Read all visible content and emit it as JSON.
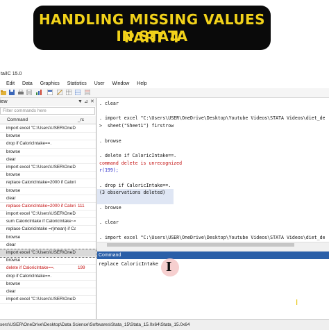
{
  "banner": {
    "line1": "HANDLING MISSING VALUES IN STATA",
    "line2": "PART 4"
  },
  "window": {
    "title": "ta/IC 15.0"
  },
  "menu": [
    "Edit",
    "Data",
    "Graphics",
    "Statistics",
    "User",
    "Window",
    "Help"
  ],
  "history": {
    "header": "iew",
    "filter_placeholder": "Filter commands here",
    "col_command": "Command",
    "col_rc": "_rc",
    "rows": [
      {
        "cmd": "import excel \"C:\\Users\\USER\\OneD...",
        "rc": "",
        "err": false
      },
      {
        "cmd": "browse",
        "rc": "",
        "err": false
      },
      {
        "cmd": "drop if CaloricIntake==.",
        "rc": "",
        "err": false
      },
      {
        "cmd": "browse",
        "rc": "",
        "err": false
      },
      {
        "cmd": "clear",
        "rc": "",
        "err": false
      },
      {
        "cmd": "import excel \"C:\\Users\\USER\\OneD...",
        "rc": "",
        "err": false
      },
      {
        "cmd": "browse",
        "rc": "",
        "err": false
      },
      {
        "cmd": "replace CaloricIntake=2000 if Caloric...",
        "rc": "",
        "err": false
      },
      {
        "cmd": "browse",
        "rc": "",
        "err": false
      },
      {
        "cmd": "clear",
        "rc": "",
        "err": false
      },
      {
        "cmd": "replace CaloricIntake=2000 if Caloric...",
        "rc": "111",
        "err": true
      },
      {
        "cmd": "import excel \"C:\\Users\\USER\\OneD...",
        "rc": "",
        "err": false
      },
      {
        "cmd": "sum CaloricIntake if CaloricIntake~=.",
        "rc": "",
        "err": false
      },
      {
        "cmd": "replace CaloricIntake =r(mean) if Calo...",
        "rc": "",
        "err": false
      },
      {
        "cmd": "browse",
        "rc": "",
        "err": false
      },
      {
        "cmd": "clear",
        "rc": "",
        "err": false
      },
      {
        "cmd": "import excel \"C:\\Users\\USER\\OneD...",
        "rc": "",
        "err": false,
        "sel": true
      },
      {
        "cmd": "browse",
        "rc": "",
        "err": false
      },
      {
        "cmd": "delete if CaloricIntake==.",
        "rc": "199",
        "err": true
      },
      {
        "cmd": "drop if CaloricIntake==.",
        "rc": "",
        "err": false
      },
      {
        "cmd": "browse",
        "rc": "",
        "err": false
      },
      {
        "cmd": "clear",
        "rc": "",
        "err": false
      },
      {
        "cmd": "import excel \"C:\\Users\\USER\\OneD...",
        "rc": "",
        "err": false
      }
    ]
  },
  "results": [
    {
      "t": ". clear",
      "c": ""
    },
    {
      "t": "",
      "c": ""
    },
    {
      "t": ". import excel \"C:\\Users\\USER\\OneDrive\\Desktop\\Youtube Videos\\STATA Videos\\diet_de",
      "c": ""
    },
    {
      "t": ">  sheet(\"Sheet1\") firstrow",
      "c": ""
    },
    {
      "t": "",
      "c": ""
    },
    {
      "t": ". browse",
      "c": ""
    },
    {
      "t": "",
      "c": ""
    },
    {
      "t": ". delete if CaloricIntake==.",
      "c": ""
    },
    {
      "t": "command delete is unrecognized",
      "c": "red"
    },
    {
      "t": "r(199);",
      "c": "blue"
    },
    {
      "t": "",
      "c": ""
    },
    {
      "t": ". drop if CaloricIntake==.",
      "c": ""
    },
    {
      "t": "(3 observations deleted)",
      "c": ""
    },
    {
      "t": "",
      "c": ""
    },
    {
      "t": ". browse",
      "c": ""
    },
    {
      "t": "",
      "c": ""
    },
    {
      "t": ". clear",
      "c": ""
    },
    {
      "t": "",
      "c": ""
    },
    {
      "t": ". import excel \"C:\\Users\\USER\\OneDrive\\Desktop\\Youtube Videos\\STATA Videos\\diet_de",
      "c": ""
    },
    {
      "t": ">  sheet(\"Sheet1\") firstrow",
      "c": ""
    }
  ],
  "command": {
    "header": "Command",
    "value": "replace CaloricIntake",
    "cursor_glyph": "I",
    "extra_glyph": "I"
  },
  "status": {
    "path": "sers\\USER\\OneDrive\\Desktop\\Data Science\\Softwares\\Stata_15\\Stata_15.0x64\\Stata_15.0x64"
  }
}
